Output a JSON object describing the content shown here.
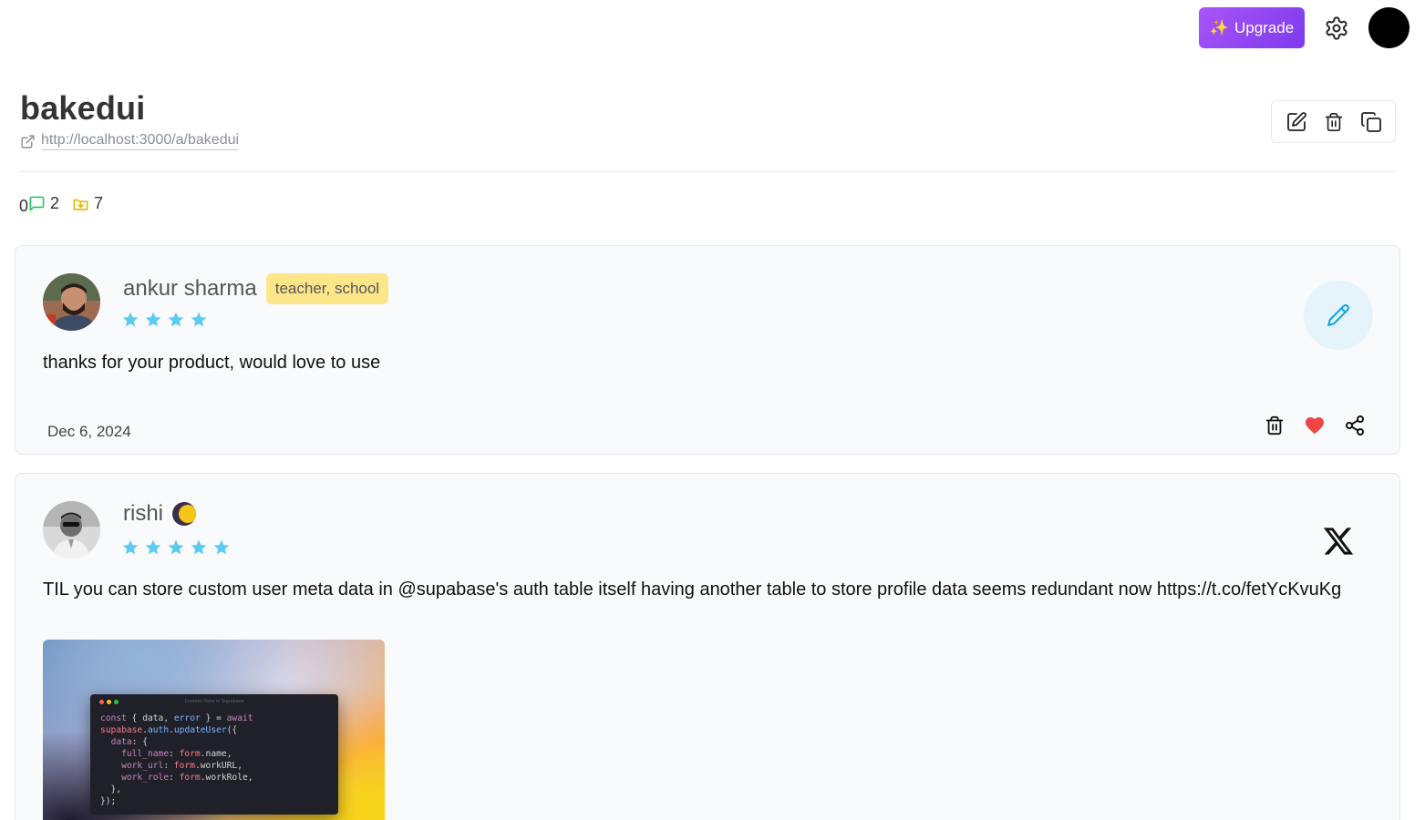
{
  "header": {
    "upgrade_label": "Upgrade",
    "upgrade_icon": "✨",
    "title": "bakedui",
    "link": "http://localhost:3000/a/bakedui"
  },
  "stats": {
    "first_value": "0",
    "comments": "2",
    "imports": "7"
  },
  "reviews": [
    {
      "name": "ankur sharma",
      "tag": "teacher, school",
      "rating": 4,
      "text": "thanks for your product, would love to use",
      "date": "Dec 6, 2024",
      "source": "edit"
    },
    {
      "name": "rishi",
      "rating": 5,
      "text": "TIL you can store custom user meta data in @supabase's auth table itself having another table to store profile data seems redundant now https://t.co/fetYcKvuKg",
      "source": "x",
      "media": {
        "window_title": "Custom Data in Supabase",
        "code_lines": [
          "const { data, error } = await",
          "supabase.auth.updateUser({",
          "  data: {",
          "    full_name: form.name,",
          "    work_url: form.workURL,",
          "    work_role: form.workRole,",
          "  },",
          "});"
        ]
      }
    }
  ],
  "colors": {
    "accent_purple": "#a855f7",
    "star_blue": "#5ccbf2",
    "badge_yellow": "#fde68a",
    "heart_red": "#ef4444",
    "comment_green": "#22c55e",
    "import_yellow": "#eab308"
  }
}
